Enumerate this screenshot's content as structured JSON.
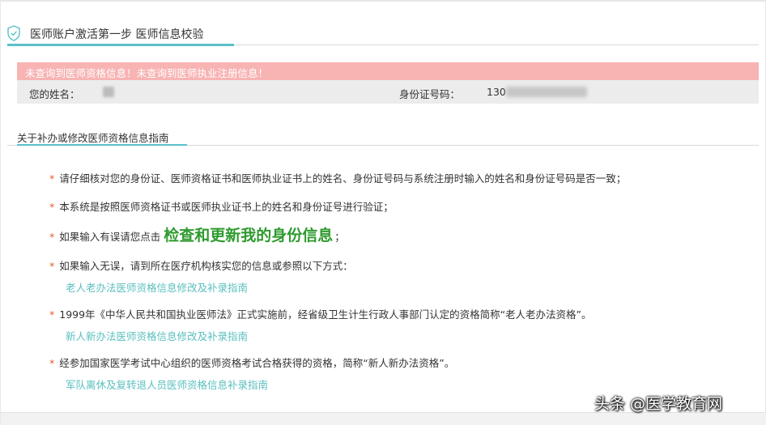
{
  "header": {
    "title": "医师账户激活第一步 医师信息校验",
    "icon": "shield-check-icon"
  },
  "alert": {
    "text": "未查询到医师资格信息！未查询到医师执业注册信息！"
  },
  "info": {
    "name_label": "您的姓名：",
    "id_label": "身份证号码：",
    "id_value": "130"
  },
  "guide": {
    "title": "关于补办或修改医师资格信息指南",
    "star": "*",
    "item1": "请仔细核对您的身份证、医师资格证书和医师执业证书上的姓名、身份证号码与系统注册时输入的姓名和身份证号码是否一致；",
    "item2": "本系统是按照医师资格证书或医师执业证书上的姓名和身份证号进行验证；",
    "item3_prefix": "如果输入有误请您点击",
    "item3_link": "检查和更新我的身份信息",
    "item3_suffix": "；",
    "item4": "如果输入无误，请到所在医疗机构核实您的信息或参照以下方式：",
    "link1": "老人老办法医师资格信息修改及补录指南",
    "item5": "1999年《中华人民共和国执业医师法》正式实施前，经省级卫生计生行政人事部门认定的资格简称“老人老办法资格”。",
    "link2": "新人新办法医师资格信息修改及补录指南",
    "item6": "经参加国家医学考试中心组织的医师资格考试合格获得的资格，简称“新人新办法资格”。",
    "link3": "军队离休及复转退人员医师资格信息补录指南"
  },
  "watermark": "头条 @医学教育网",
  "colors": {
    "accent": "#5bc0c8",
    "alert_bg": "#f8b3b3",
    "link_green": "#2e9a2e",
    "star": "#e05a2b"
  }
}
